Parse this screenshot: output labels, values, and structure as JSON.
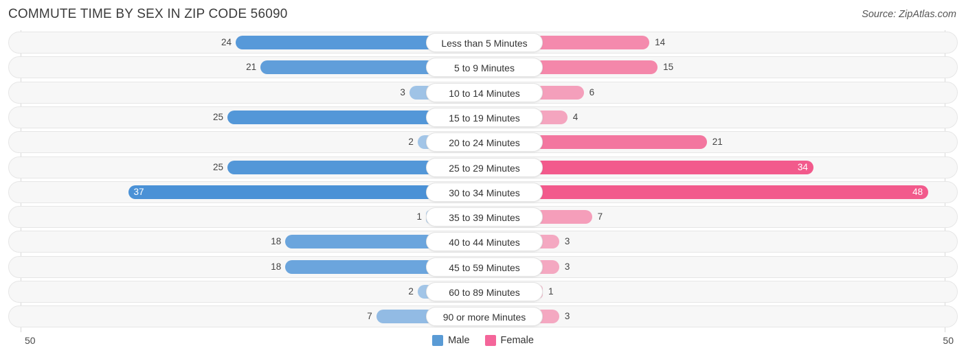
{
  "header": {
    "title": "COMMUTE TIME BY SEX IN ZIP CODE 56090",
    "source": "Source: ZipAtlas.com"
  },
  "legend": {
    "male": {
      "label": "Male",
      "color": "#5a9bd5"
    },
    "female": {
      "label": "Female",
      "color": "#f4669a"
    }
  },
  "axis": {
    "left_tick": "50",
    "right_tick": "50",
    "max": 50
  },
  "chart_data": {
    "type": "bar",
    "orientation": "horizontal-diverging",
    "title": "COMMUTE TIME BY SEX IN ZIP CODE 56090",
    "xlabel": "",
    "ylabel": "",
    "xlim": [
      50,
      50
    ],
    "grid": false,
    "legend_position": "bottom-center",
    "categories": [
      "Less than 5 Minutes",
      "5 to 9 Minutes",
      "10 to 14 Minutes",
      "15 to 19 Minutes",
      "20 to 24 Minutes",
      "25 to 29 Minutes",
      "30 to 34 Minutes",
      "35 to 39 Minutes",
      "40 to 44 Minutes",
      "45 to 59 Minutes",
      "60 to 89 Minutes",
      "90 or more Minutes"
    ],
    "series": [
      {
        "name": "Male",
        "values": [
          24,
          21,
          3,
          25,
          2,
          25,
          37,
          1,
          18,
          18,
          2,
          7
        ]
      },
      {
        "name": "Female",
        "values": [
          14,
          15,
          6,
          4,
          21,
          34,
          48,
          7,
          3,
          3,
          1,
          3
        ]
      }
    ]
  },
  "rows": [
    {
      "label": "Less than 5 Minutes",
      "male": "24",
      "female": "14",
      "male_inside": false,
      "female_inside": false
    },
    {
      "label": "5 to 9 Minutes",
      "male": "21",
      "female": "15",
      "male_inside": false,
      "female_inside": false
    },
    {
      "label": "10 to 14 Minutes",
      "male": "3",
      "female": "6",
      "male_inside": false,
      "female_inside": false
    },
    {
      "label": "15 to 19 Minutes",
      "male": "25",
      "female": "4",
      "male_inside": false,
      "female_inside": false
    },
    {
      "label": "20 to 24 Minutes",
      "male": "2",
      "female": "21",
      "male_inside": false,
      "female_inside": false
    },
    {
      "label": "25 to 29 Minutes",
      "male": "25",
      "female": "34",
      "male_inside": false,
      "female_inside": true
    },
    {
      "label": "30 to 34 Minutes",
      "male": "37",
      "female": "48",
      "male_inside": true,
      "female_inside": true
    },
    {
      "label": "35 to 39 Minutes",
      "male": "1",
      "female": "7",
      "male_inside": false,
      "female_inside": false
    },
    {
      "label": "40 to 44 Minutes",
      "male": "18",
      "female": "3",
      "male_inside": false,
      "female_inside": false
    },
    {
      "label": "45 to 59 Minutes",
      "male": "18",
      "female": "3",
      "male_inside": false,
      "female_inside": false
    },
    {
      "label": "60 to 89 Minutes",
      "male": "2",
      "female": "1",
      "male_inside": false,
      "female_inside": false
    },
    {
      "label": "90 or more Minutes",
      "male": "7",
      "female": "3",
      "male_inside": false,
      "female_inside": false
    }
  ]
}
